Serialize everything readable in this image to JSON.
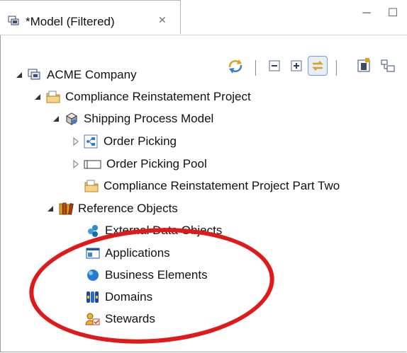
{
  "tab": {
    "title": "*Model (Filtered)",
    "close": "✕"
  },
  "window_controls": {
    "minimize": "─",
    "maximize": "☐"
  },
  "toolbar": {
    "items": [
      "sync-icon",
      "collapse-all-icon",
      "expand-all-icon",
      "link-with-editor-icon",
      "new-model-icon",
      "layout-icon"
    ]
  },
  "tree": [
    {
      "label": "ACME Company",
      "icon": "enterprise-icon",
      "expanded": true
    },
    {
      "label": "Compliance Reinstatement Project",
      "icon": "project-folder-icon",
      "expanded": true
    },
    {
      "label": "Shipping Process Model",
      "icon": "process-model-icon",
      "expanded": true
    },
    {
      "label": "Order Picking",
      "icon": "process-diagram-icon",
      "expanded": false
    },
    {
      "label": "Order Picking Pool",
      "icon": "pool-icon",
      "expanded": false
    },
    {
      "label": "Compliance Reinstatement Project Part Two",
      "icon": "project-folder-icon",
      "expanded": null
    },
    {
      "label": "Reference Objects",
      "icon": "library-icon",
      "expanded": true
    },
    {
      "label": "External Data Objects",
      "icon": "data-objects-icon",
      "expanded": null
    },
    {
      "label": "Applications",
      "icon": "application-icon",
      "expanded": null
    },
    {
      "label": "Business Elements",
      "icon": "business-element-icon",
      "expanded": null
    },
    {
      "label": "Domains",
      "icon": "domain-icon",
      "expanded": null
    },
    {
      "label": "Stewards",
      "icon": "steward-icon",
      "expanded": null
    }
  ],
  "annotation_color": "#e01a1a"
}
